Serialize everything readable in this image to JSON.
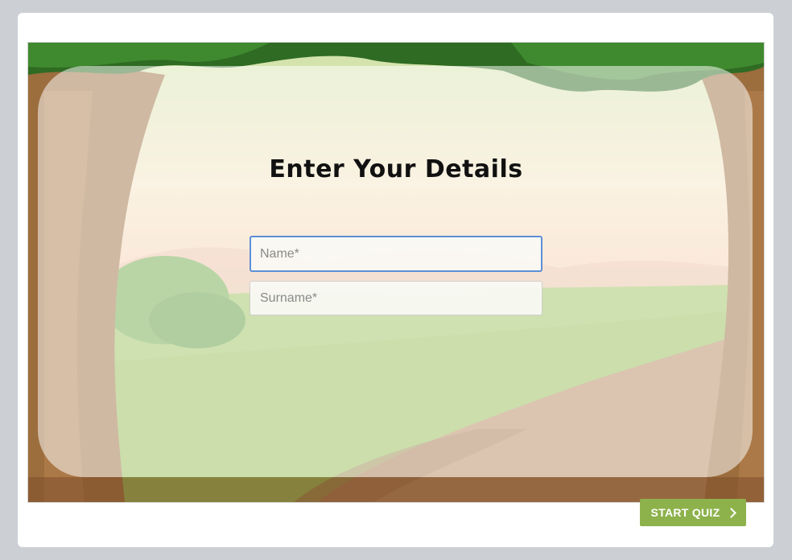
{
  "form": {
    "title": "Enter Your Details",
    "name_placeholder": "Name*",
    "surname_placeholder": "Surname*",
    "name_value": "",
    "surname_value": ""
  },
  "footer": {
    "start_label": "START QUIZ"
  },
  "colors": {
    "button": "#8db24c",
    "focus_border": "#5b8fd6",
    "page_bg": "#ccd0d4"
  },
  "icons": {
    "start_button_icon": "chevron-right-icon"
  }
}
